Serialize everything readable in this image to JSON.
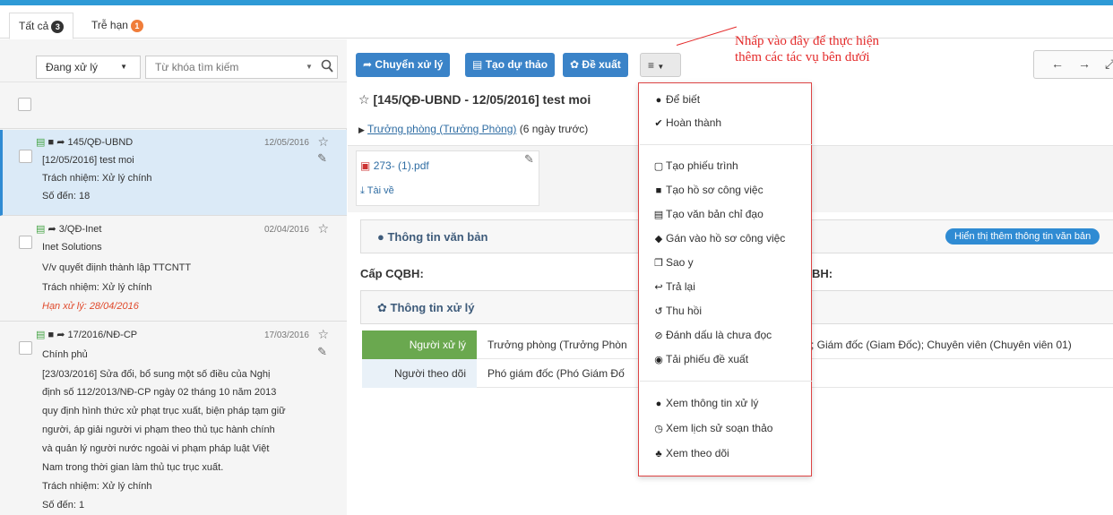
{
  "tabs": [
    {
      "label": "Tất cả",
      "badge": "3"
    },
    {
      "label": "Trễ hạn",
      "badge": "1"
    }
  ],
  "filter": {
    "status_value": "Đang xử lý",
    "search_placeholder": "Từ khóa tìm kiếm"
  },
  "list": [
    {
      "code": "145/QĐ-UBND",
      "date": "12/05/2016",
      "subject": "[12/05/2016] test moi",
      "responsibility": "Trách nhiệm: Xử lý chính",
      "number": "Số đến: 18"
    },
    {
      "code": "3/QĐ-Inet",
      "date": "02/04/2016",
      "sender": "Inet Solutions",
      "subject": "V/v quyết điịnh thành lập TTCNTT",
      "responsibility": "Trách nhiệm: Xử lý chính",
      "deadline": "Hạn xử lý: 28/04/2016"
    },
    {
      "code": "17/2016/NĐ-CP",
      "date": "17/03/2016",
      "sender": "Chính phủ",
      "subject_lines": [
        "[23/03/2016] Sửa đổi, bổ sung một số điều của Nghị",
        "định số 112/2013/NĐ-CP ngày 02 tháng 10 năm 2013",
        "quy định hình thức xử phạt trục xuất, biện pháp tạm giữ",
        "người, áp giải người vi phạm theo thủ tục hành chính",
        "và quản lý người nước ngoài vi phạm pháp luật Việt",
        "Nam trong thời gian làm thủ tục trục xuất."
      ],
      "responsibility": "Trách nhiệm: Xử lý chính",
      "number": "Số đến: 1"
    }
  ],
  "toolbar": {
    "transfer": "Chuyển xử lý",
    "draft": "Tạo dự thảo",
    "propose": "Đề xuất"
  },
  "annotation": {
    "line1": "Nhấp vào đây để thực hiện",
    "line2": "thêm các tác vụ bên dưới"
  },
  "document": {
    "title": "[145/QĐ-UBND - 12/05/2016] test moi",
    "sender_link": "Trưởng phòng (Trưởng Phòng)",
    "sender_time": "(6 ngày trước)",
    "attachment": "273- (1).pdf",
    "download": "Tài về"
  },
  "sections": {
    "info": "Thông tin văn bản",
    "more_info": "Hiển thị thêm thông tin văn bản",
    "cap_left": "Cấp CQBH:",
    "cap_right": "BH:",
    "process": "Thông tin xử lý"
  },
  "process_table": {
    "handler_label": "Người xử lý",
    "handler_value": "Trưởng phòng (Trưởng Phòn",
    "handler_value_right": "; Giám đốc (Giam Đốc); Chuyên viên (Chuyên viên 01)",
    "watcher_label": "Người theo dõi",
    "watcher_value": "Phó giám đốc (Phó Giám Đố"
  },
  "menu": {
    "group1": [
      "Để biết",
      "Hoàn thành"
    ],
    "group2": [
      "Tạo phiếu trình",
      "Tạo hồ sơ công việc",
      "Tạo văn bản chỉ đạo",
      "Gán vào hồ sơ công việc",
      "Sao y",
      "Trả lại",
      "Thu hồi",
      "Đánh dấu là chưa đọc",
      "Tải phiếu đề xuất"
    ],
    "group3": [
      "Xem thông tin xử lý",
      "Xem lịch sử soạn thảo",
      "Xem theo dõi"
    ]
  },
  "colors": {
    "accent": "#3a83c8",
    "handler_bg": "#6aa84f",
    "annotation": "#e42b2b",
    "badge_late": "#f07d3a"
  }
}
